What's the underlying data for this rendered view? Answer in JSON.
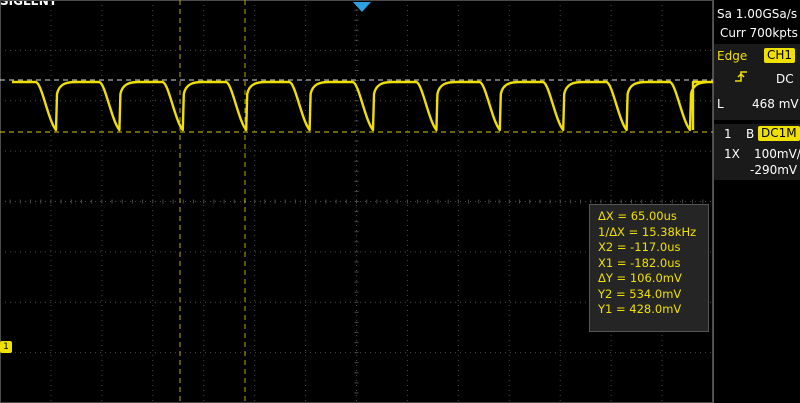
{
  "header": {
    "brand": "SIGLENT"
  },
  "panel": {
    "sample_rate": "Sa 1.00GSa/s",
    "memory_depth": "Curr 700kpts",
    "trigger": {
      "type": "Edge",
      "source": "CH1",
      "coupling": "DC",
      "level_label": "L",
      "level": "468 mV"
    },
    "channel": {
      "number": "1",
      "bw_label": "B",
      "coupling": "DC1M",
      "probe": "1X",
      "scale": "100mV/",
      "offset": "-290mV"
    }
  },
  "measurement": {
    "delta_x": "ΔX = 65.00us",
    "inv_delta_x": "1/ΔX = 15.38kHz",
    "x2": "X2 = -117.0us",
    "x1": "X1 = -182.0us",
    "delta_y": "ΔY = 106.0mV",
    "y2": "Y2 = 534.0mV",
    "y1": "Y1 = 428.0mV"
  },
  "markers": {
    "channel_marker": "1"
  },
  "colors": {
    "trace": "#f0e000",
    "background": "#000000",
    "grid": "#4a4a4a"
  }
}
